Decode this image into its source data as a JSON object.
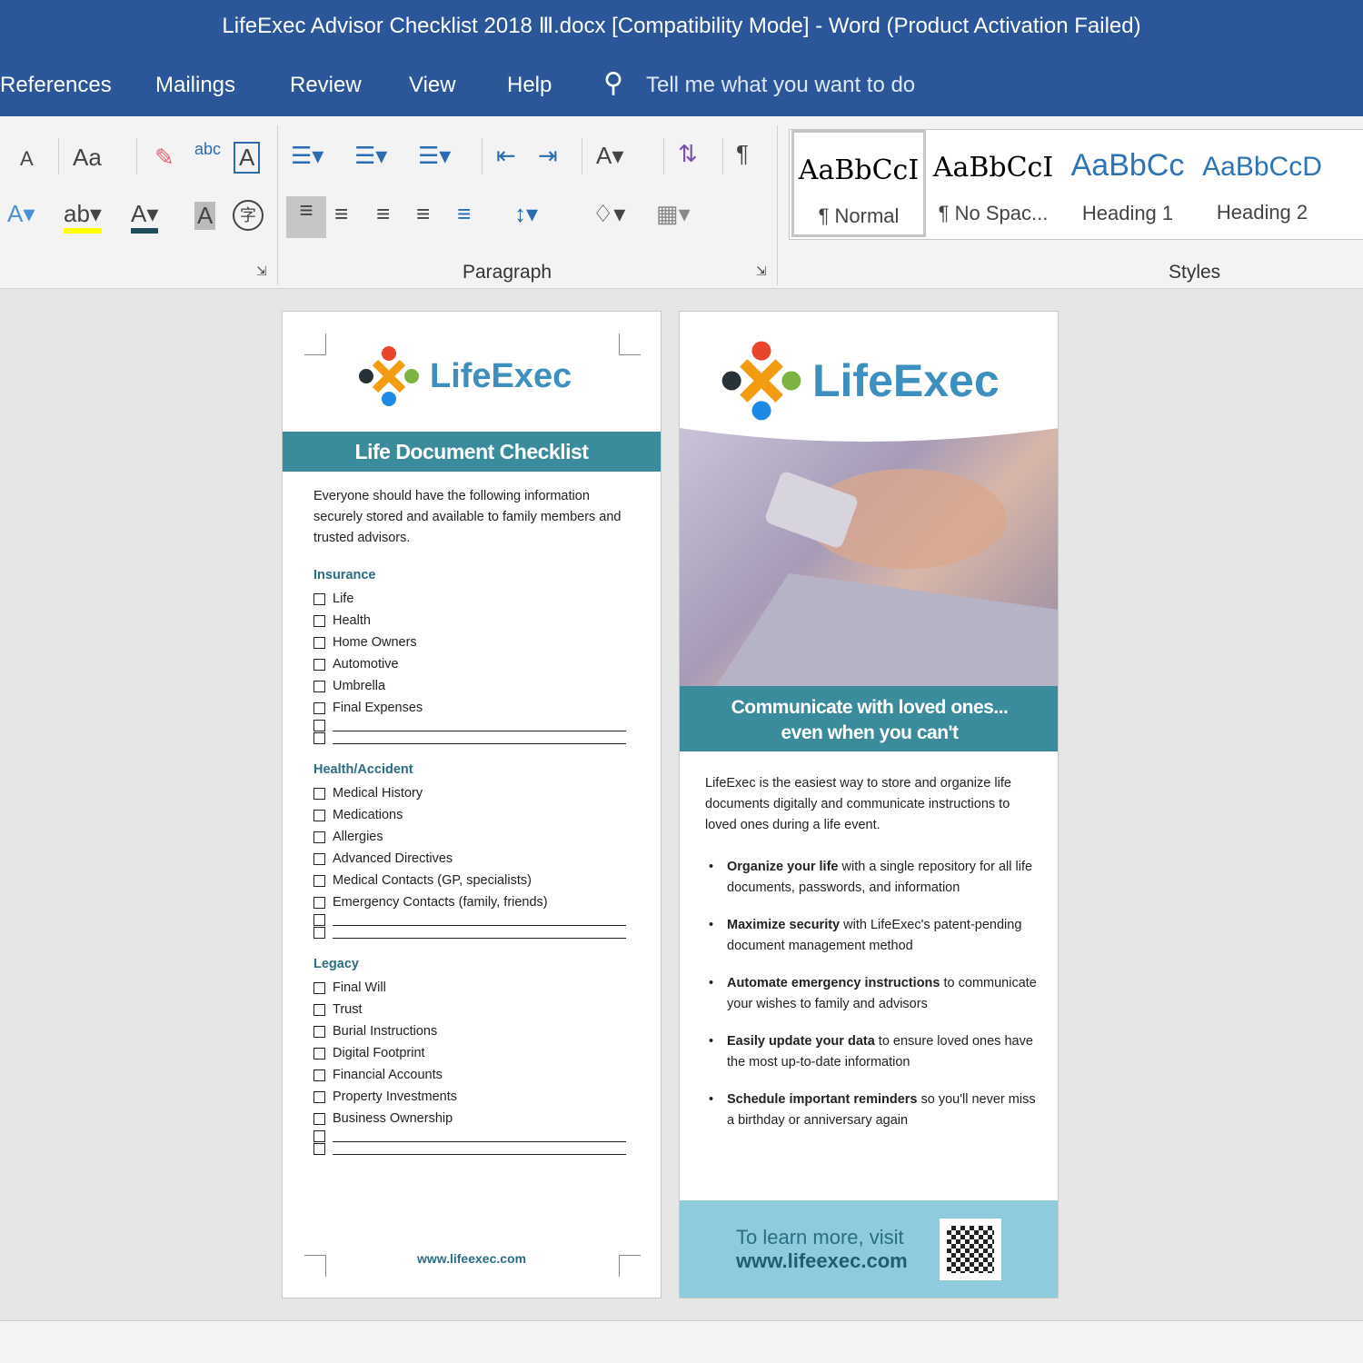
{
  "window": {
    "title": "LifeExec Advisor Checklist 2018 Ⅲ.docx [Compatibility Mode]  -  Word (Product Activation Failed)"
  },
  "menu": {
    "tabs": [
      "References",
      "Mailings",
      "Review",
      "View",
      "Help"
    ],
    "tell_me": "Tell me what you want to do"
  },
  "ribbon": {
    "font_group_labels": {
      "change_case": "Aa",
      "grow": "A",
      "clear": "A",
      "text_effect": "A",
      "char_shading": "A",
      "enclose": "字"
    },
    "paragraph_label": "Paragraph",
    "styles_label": "Styles",
    "styles": [
      {
        "preview": "AaBbCcI",
        "name": "¶ Normal"
      },
      {
        "preview": "AaBbCcI",
        "name": "¶ No Spac..."
      },
      {
        "preview": "AaBbCc",
        "name": "Heading 1"
      },
      {
        "preview": "AaBbCcD",
        "name": "Heading 2"
      }
    ]
  },
  "page1": {
    "logo": "LifeExec",
    "title": "Life Document Checklist",
    "intro": "Everyone should have the following information securely stored and available to family members and trusted advisors.",
    "sections": [
      {
        "heading": "Insurance",
        "items": [
          "Life",
          "Health",
          "Home Owners",
          "Automotive",
          "Umbrella",
          "Final Expenses"
        ],
        "blank_lines": 2
      },
      {
        "heading": "Health/Accident",
        "items": [
          "Medical History",
          "Medications",
          "Allergies",
          "Advanced Directives",
          "Medical Contacts (GP, specialists)",
          "Emergency Contacts (family, friends)"
        ],
        "blank_lines": 2
      },
      {
        "heading": "Legacy",
        "items": [
          "Final Will",
          "Trust",
          "Burial Instructions",
          "Digital Footprint",
          "Financial Accounts",
          "Property Investments",
          "Business Ownership"
        ],
        "blank_lines": 2
      }
    ],
    "footer_url": "www.lifeexec.com"
  },
  "page2": {
    "logo": "LifeExec",
    "banner_line1": "Communicate with loved ones...",
    "banner_line2": "even when you can't",
    "intro": "LifeExec is the easiest way to store and organize life documents digitally and communicate instructions to loved ones during a life event.",
    "bullets": [
      {
        "bold": "Organize your life",
        "rest": " with a single repository for all life documents, passwords, and information"
      },
      {
        "bold": "Maximize security",
        "rest": " with LifeExec's patent-pending document management method"
      },
      {
        "bold": "Automate emergency instructions",
        "rest": " to communicate your wishes to family and advisors"
      },
      {
        "bold": "Easily update your data",
        "rest": " to ensure loved ones have the most up-to-date information"
      },
      {
        "bold": "Schedule important reminders",
        "rest": " so you'll never miss a birthday or anniversary again"
      }
    ],
    "cta_line1": "To learn more, visit",
    "cta_url": "www.lifeexec.com"
  },
  "colors": {
    "word_blue": "#2b579a",
    "teal": "#3a8c9c",
    "light_teal": "#8ecbdc"
  }
}
